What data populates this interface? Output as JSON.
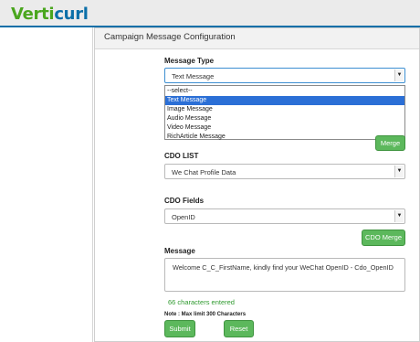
{
  "app": {
    "logo_part1": "Verti",
    "logo_part2": "curl"
  },
  "page": {
    "title": "Campaign Message Configuration"
  },
  "message_type": {
    "label": "Message Type",
    "selected": "Text Message",
    "options": [
      "--select--",
      "Text Message",
      "Image Message",
      "Audio Message",
      "Video Message",
      "RichArticle Message"
    ],
    "highlighted_index": 1,
    "merge_label": "Merge"
  },
  "cdo_list": {
    "label": "CDO LIST",
    "selected": "We Chat Profile Data"
  },
  "cdo_fields": {
    "label": "CDO Fields",
    "selected": "OpenID",
    "merge_label": "CDO Merge"
  },
  "message": {
    "label": "Message",
    "value": "Welcome C_C_FirstName, kindly find your WeChat OpenID - Cdo_OpenID",
    "counter": "66 characters entered",
    "note": "Note : Max limit 300 Characters"
  },
  "actions": {
    "submit_label": "Submit",
    "reset_label": "Reset"
  },
  "colors": {
    "brand_green": "#4aa61e",
    "brand_blue": "#0b6fa8",
    "button_green": "#5cb85c",
    "highlight_blue": "#2b6fd6"
  },
  "icons": {
    "select_arrow": "chevron-down-icon"
  }
}
